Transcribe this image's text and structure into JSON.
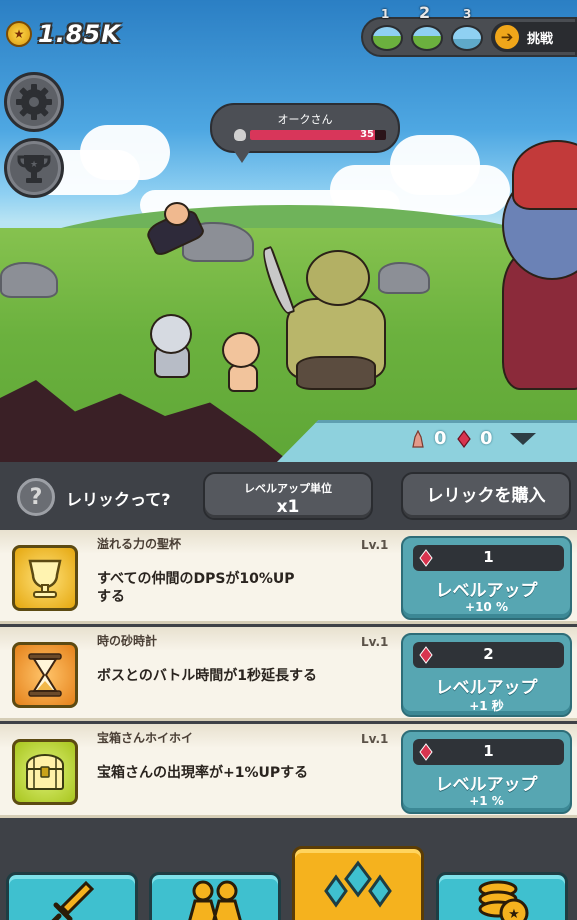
{
  "hud": {
    "gold_amount": "1.85K",
    "stages": [
      {
        "label": "1"
      },
      {
        "label": "2"
      },
      {
        "label": "3"
      }
    ],
    "challenge_label": "挑戦"
  },
  "enemy": {
    "name": "オークさん",
    "hp_value": "35",
    "hp_fraction": 0.92
  },
  "resources": {
    "relic_shards": "0",
    "gems": "0"
  },
  "relic_panel": {
    "help_label": "レリックって?",
    "level_unit_title": "レベルアップ単位",
    "level_unit_value": "x1",
    "buy_relic_label": "レリックを購入",
    "relics": [
      {
        "name": "溢れる力の聖杯",
        "level": "Lv.1",
        "description": "すべての仲間のDPSが10%UPする",
        "cost": "1",
        "button_label": "レベルアップ",
        "bonus": "+10 %",
        "icon": "holy-grail-icon"
      },
      {
        "name": "時の砂時計",
        "level": "Lv.1",
        "description": "ボスとのバトル時間が1秒延長する",
        "cost": "2",
        "button_label": "レベルアップ",
        "bonus": "+1 秒",
        "icon": "hourglass-icon"
      },
      {
        "name": "宝箱さんホイホイ",
        "level": "Lv.1",
        "description": "宝箱さんの出現率が+1%UPする",
        "cost": "1",
        "button_label": "レベルアップ",
        "bonus": "+1 %",
        "icon": "treasure-chest-icon"
      }
    ]
  },
  "bottom_nav": {
    "tabs": [
      {
        "icon": "sword-icon",
        "active": false
      },
      {
        "icon": "party-icon",
        "active": false
      },
      {
        "icon": "relic-gems-icon",
        "active": true
      },
      {
        "icon": "coins-icon",
        "active": false
      }
    ]
  },
  "colors": {
    "accent_teal": "#57a6b2",
    "active_tab": "#f5b21e",
    "hp_bar": "#d8365a",
    "gem_red": "#d8344f"
  }
}
